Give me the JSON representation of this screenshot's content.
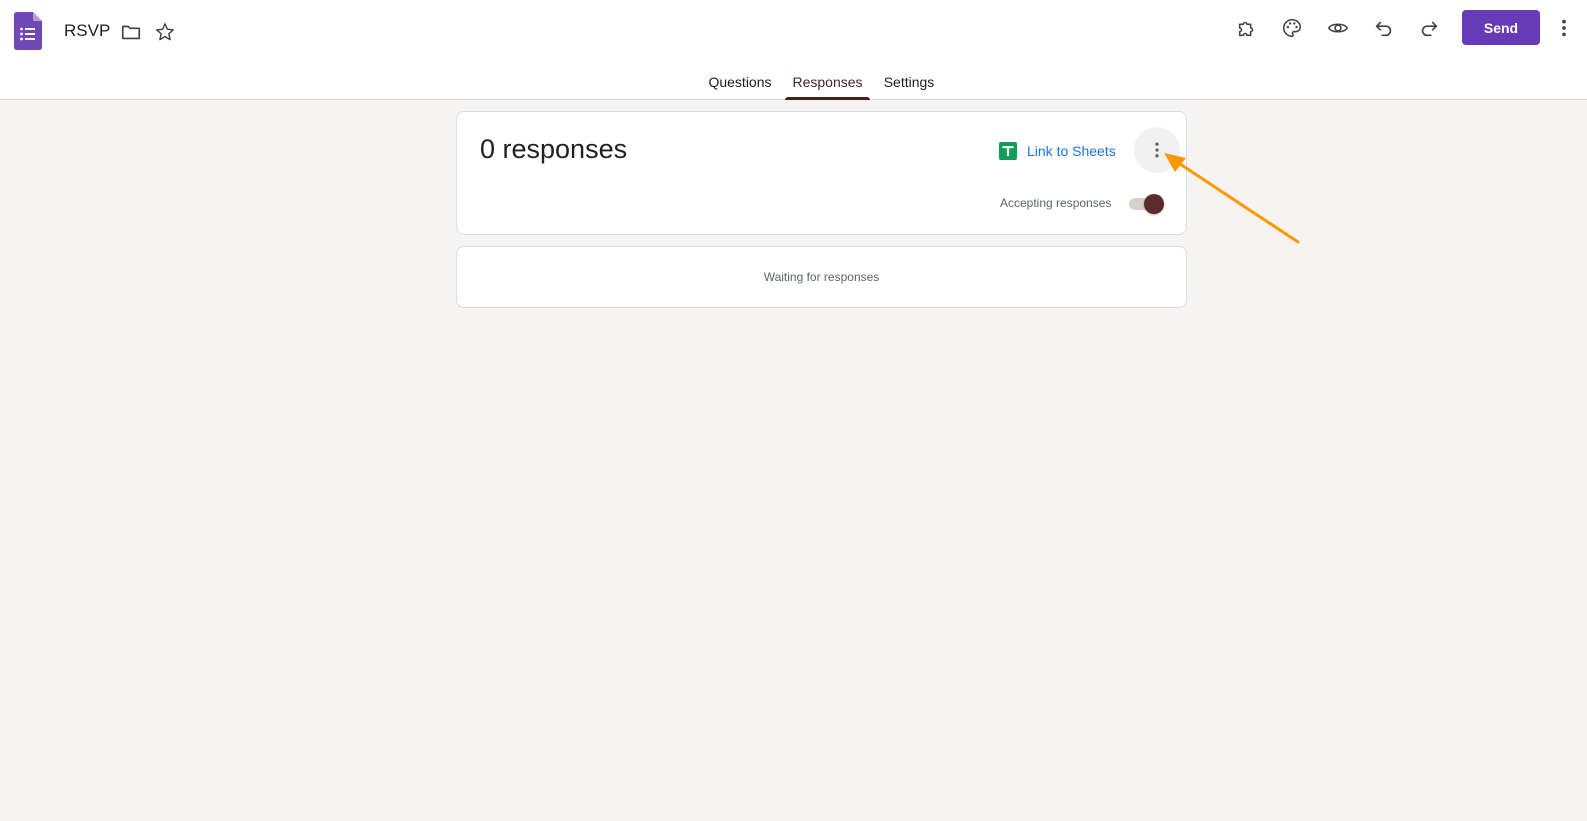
{
  "header": {
    "title": "RSVP",
    "icons": {
      "app": "forms-logo-icon",
      "folder": "folder-icon",
      "star": "star-icon",
      "addons": "puzzle-icon",
      "theme": "palette-icon",
      "preview": "eye-icon",
      "undo": "undo-icon",
      "redo": "redo-icon",
      "more": "more-vert-icon"
    },
    "send_label": "Send"
  },
  "tabs": [
    {
      "label": "Questions",
      "active": false
    },
    {
      "label": "Responses",
      "active": true
    },
    {
      "label": "Settings",
      "active": false
    }
  ],
  "responses": {
    "count_label": "0 responses",
    "link_sheets_label": "Link to Sheets",
    "accepting_label": "Accepting responses",
    "accepting": true,
    "waiting_label": "Waiting for responses"
  },
  "colors": {
    "brand": "#673ab7",
    "accent_tab": "#4a1f1f",
    "link": "#1a73e8",
    "sheets_green": "#0f9d58",
    "annotation_arrow": "#ff9800"
  }
}
